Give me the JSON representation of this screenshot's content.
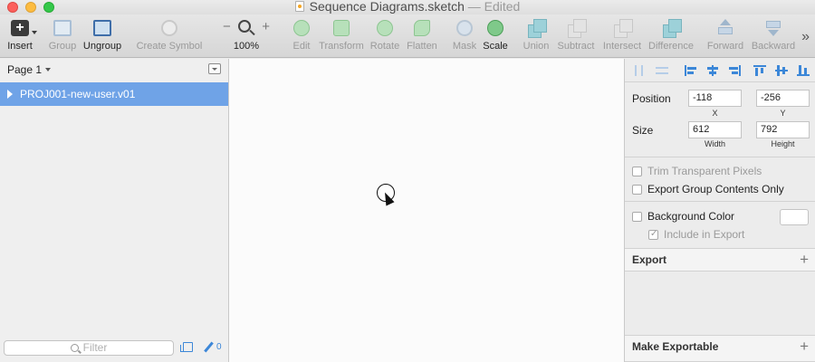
{
  "window": {
    "title": "Sequence Diagrams.sketch",
    "title_separator": "—",
    "title_status": "Edited"
  },
  "toolbar": {
    "insert": "Insert",
    "group": "Group",
    "ungroup": "Ungroup",
    "create_symbol": "Create Symbol",
    "zoom_level": "100%",
    "zoom_minus": "−",
    "zoom_plus": "+",
    "edit": "Edit",
    "transform": "Transform",
    "rotate": "Rotate",
    "flatten": "Flatten",
    "mask": "Mask",
    "scale": "Scale",
    "union": "Union",
    "subtract": "Subtract",
    "intersect": "Intersect",
    "difference": "Difference",
    "forward": "Forward",
    "backward": "Backward",
    "overflow": "»"
  },
  "sidebar": {
    "page_label": "Page 1",
    "layers": [
      {
        "name": "PROJ001-new-user.v01",
        "selected": true
      }
    ],
    "filter_placeholder": "Filter",
    "slice_count": "0"
  },
  "inspector": {
    "position_label": "Position",
    "position_x": "-118",
    "position_y": "-256",
    "x_label": "X",
    "y_label": "Y",
    "size_label": "Size",
    "width": "612",
    "height": "792",
    "width_label": "Width",
    "height_label": "Height",
    "trim_transparent": "Trim Transparent Pixels",
    "export_group_contents": "Export Group Contents Only",
    "background_color": "Background Color",
    "include_in_export": "Include in Export",
    "export_section": "Export",
    "make_exportable": "Make Exportable",
    "add_symbol": "+"
  },
  "colors": {
    "selection": "#6fa3e7",
    "accent": "#3c87d8"
  }
}
